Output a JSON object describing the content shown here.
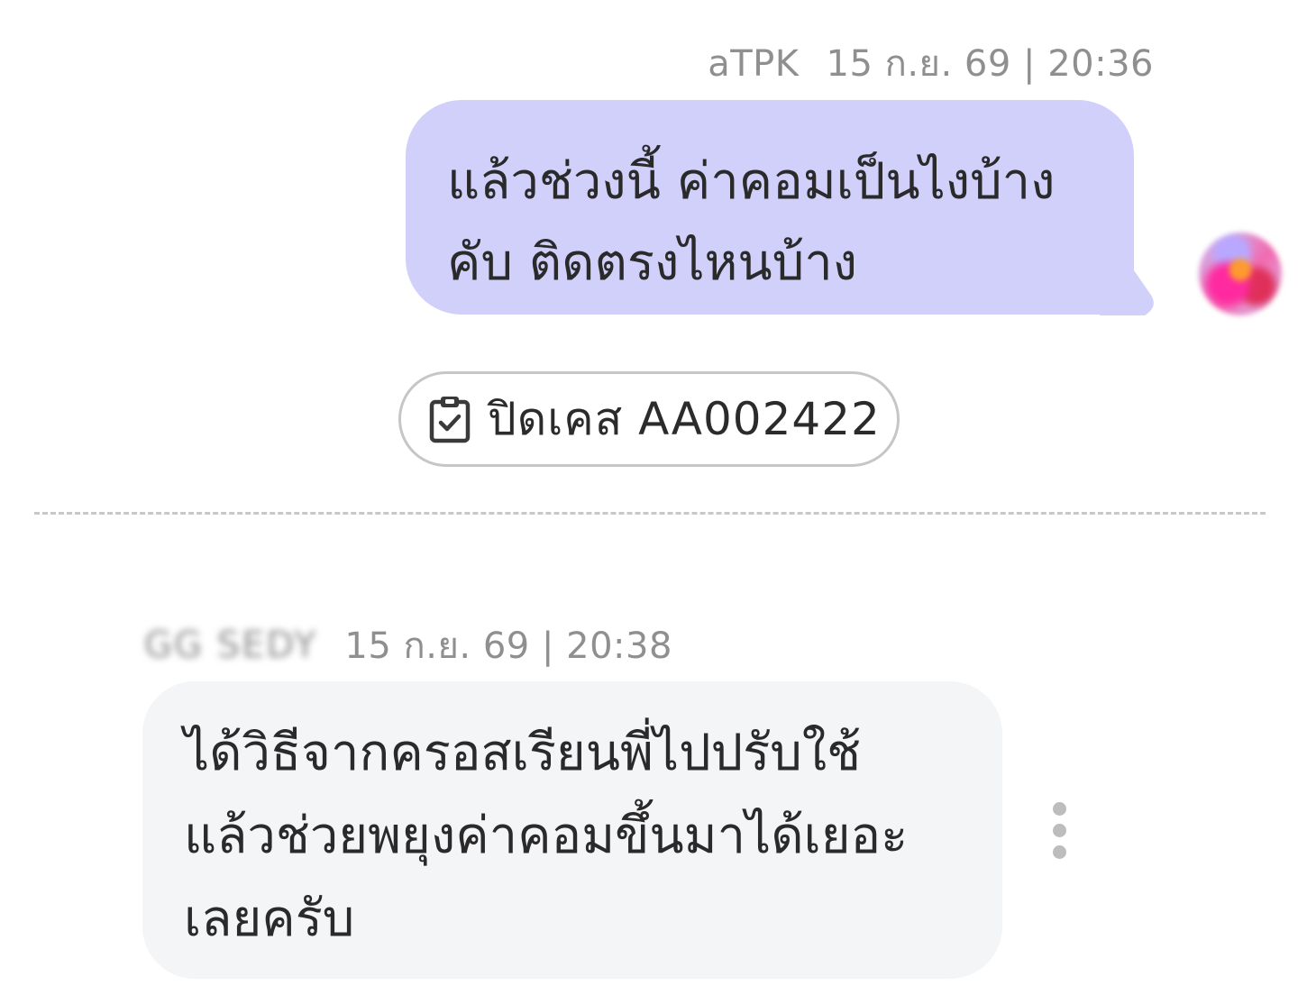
{
  "outgoing_message": {
    "sender": "aTPK",
    "timestamp": "15 ก.ย. 69 | 20:36",
    "line1": "แล้วช่วงนี้ ค่าคอมเป็นไงบ้าง",
    "line2": "คับ ติดตรงไหนบ้าง",
    "bubble_color": "#d0d0fa"
  },
  "case_event": {
    "icon": "clipboard-check-icon",
    "label": "ปิดเคส AA002422"
  },
  "incoming_message": {
    "sender": "GG SEDY",
    "timestamp": "15 ก.ย. 69 | 20:38",
    "line1": "ได้วิธีจากครอสเรียนพี่ไปปรับใช้",
    "line2": "แล้วช่วยพยุงค่าคอมขึ้นมาได้เยอะ",
    "line3": "เลยครับ",
    "bubble_color": "#f4f5f7",
    "more_icon": "more-vertical-icon"
  }
}
